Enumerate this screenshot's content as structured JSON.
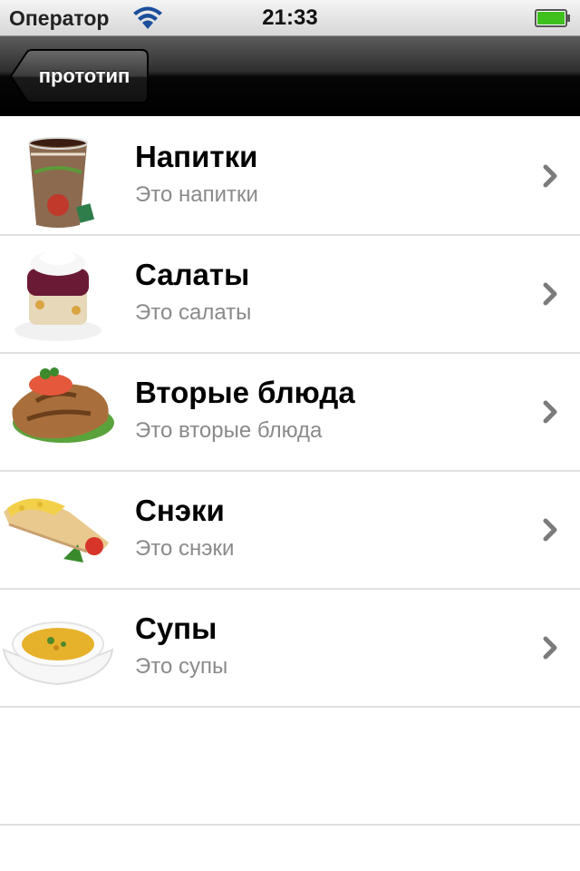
{
  "status_bar": {
    "carrier": "Оператор",
    "time": "21:33",
    "wifi_icon": "wifi-icon",
    "battery_icon": "battery-icon",
    "battery_color": "#3fc01f"
  },
  "nav_bar": {
    "back_label": "прототип"
  },
  "menu": {
    "items": [
      {
        "title": "Напитки",
        "subtitle": "Это напитки",
        "image": "coffee-cup-image"
      },
      {
        "title": "Салаты",
        "subtitle": "Это салаты",
        "image": "salad-image"
      },
      {
        "title": "Вторые блюда",
        "subtitle": "Это вторые блюда",
        "image": "main-course-image"
      },
      {
        "title": "Снэки",
        "subtitle": "Это снэки",
        "image": "snack-roll-image"
      },
      {
        "title": "Супы",
        "subtitle": "Это супы",
        "image": "soup-bowl-image"
      }
    ]
  }
}
